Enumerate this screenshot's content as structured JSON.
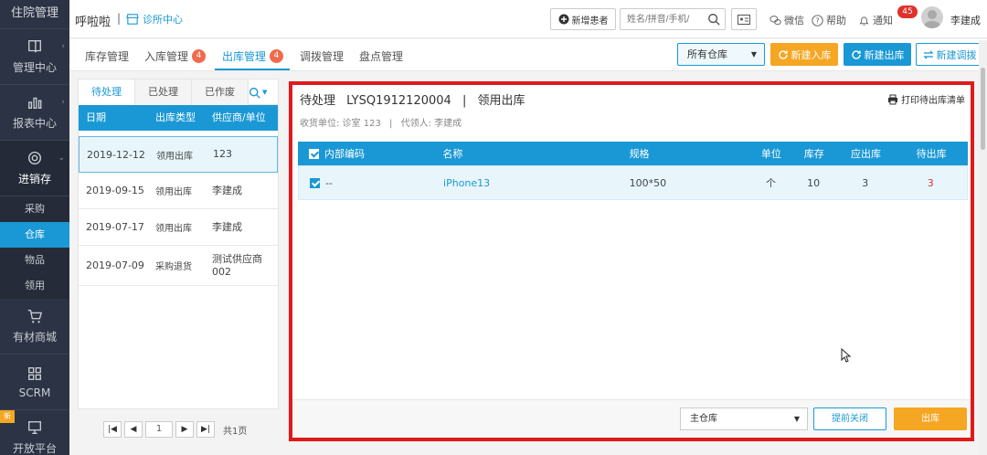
{
  "sidebar": {
    "brand": "住院管理",
    "items": [
      {
        "label": "管理中心",
        "icon": "book-icon"
      },
      {
        "label": "报表中心",
        "icon": "bar-chart-icon"
      },
      {
        "label": "进销存",
        "icon": "settings-wheel-icon"
      },
      {
        "label": "有材商城",
        "icon": "cart-icon"
      },
      {
        "label": "SCRM",
        "icon": "grid-icon"
      },
      {
        "label": "开放平台",
        "icon": "monitor-icon",
        "badge": "新"
      }
    ],
    "subitems": [
      "采购",
      "仓库",
      "物品",
      "领用"
    ],
    "active_subitem": "仓库"
  },
  "header": {
    "brand": "呼啦啦",
    "separator": "|",
    "clinic": "诊所中心",
    "add_patient": "新增患者",
    "search_placeholder": "姓名/拼音/手机/",
    "wechat": "微信",
    "help": "帮助",
    "notify": "通知",
    "notify_count": "45",
    "user": "李建成"
  },
  "tabs": [
    {
      "label": "库存管理",
      "badge": ""
    },
    {
      "label": "入库管理",
      "badge": "4"
    },
    {
      "label": "出库管理",
      "badge": "4"
    },
    {
      "label": "调拨管理",
      "badge": ""
    },
    {
      "label": "盘点管理",
      "badge": ""
    }
  ],
  "toolbar": {
    "warehouse_select": "所有仓库",
    "new_in": "新建入库",
    "new_out": "新建出库",
    "new_transfer": "新建调拨"
  },
  "left_panel": {
    "tabs": [
      "待处理",
      "已处理",
      "已作废"
    ],
    "columns": [
      "日期",
      "出库类型",
      "供应商/单位"
    ],
    "rows": [
      {
        "date": "2019-12-12",
        "type": "领用出库",
        "unit": "123"
      },
      {
        "date": "2019-09-15",
        "type": "领用出库",
        "unit": "李建成"
      },
      {
        "date": "2019-07-17",
        "type": "领用出库",
        "unit": "李建成"
      },
      {
        "date": "2019-07-09",
        "type": "采购退货",
        "unit": "测试供应商002"
      }
    ],
    "pager": {
      "current": "1",
      "total": "共1页"
    }
  },
  "detail": {
    "status": "待处理",
    "order_no": "LYSQ1912120004",
    "sep": "|",
    "type": "领用出库",
    "print": "打印待出库清单",
    "receiver_label": "收货单位: 诊室 123",
    "info_sep": "|",
    "agent_label": "代领人: 李建成",
    "columns": {
      "code": "内部编码",
      "name": "名称",
      "spec": "规格",
      "unit": "单位",
      "stock": "库存",
      "due": "应出库",
      "wait": "待出库"
    },
    "rows": [
      {
        "code": "--",
        "name": "iPhone13",
        "spec": "100*50",
        "unit": "个",
        "stock": "10",
        "due": "3",
        "wait": "3"
      }
    ],
    "footer": {
      "warehouse": "主仓库",
      "close": "提前关闭",
      "submit": "出库"
    }
  },
  "colors": {
    "primary": "#1a98d5",
    "orange": "#f5a623",
    "highlight_border": "#e0191b",
    "sidebar_bg": "#2c3344"
  }
}
